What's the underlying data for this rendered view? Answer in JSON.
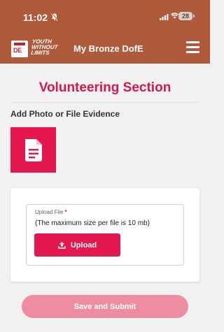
{
  "status_bar": {
    "time": "11:02",
    "battery": "28"
  },
  "header": {
    "logo_text": "DE",
    "brand_line1": "YOUTH",
    "brand_line2": "WITHOUT",
    "brand_line3": "LIMITS",
    "title": "My Bronze DofE"
  },
  "main": {
    "section_title": "Volunteering Section",
    "evidence_label": "Add Photo or File Evidence",
    "upload": {
      "field_label": "Upload File",
      "required_mark": "*",
      "size_note": "(The maximum size per file is 10 mb)",
      "button_label": "Upload"
    },
    "submit_label": "Save and Submit"
  },
  "colors": {
    "header_bg": "#b05a3c",
    "accent": "#e4174e",
    "title": "#d31a4a",
    "submit_bg": "#ee8da1"
  }
}
